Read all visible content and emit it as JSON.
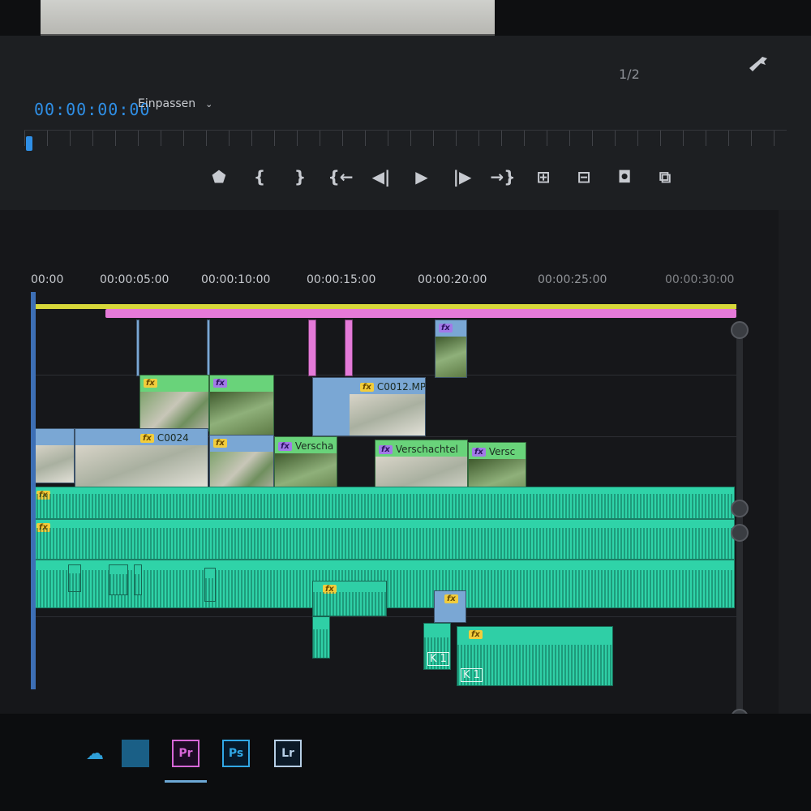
{
  "monitor": {
    "timecode": "00:00:00:00",
    "fit_label": "Einpassen",
    "resolution": "1/2"
  },
  "transport": [
    {
      "name": "add-marker-button",
      "icon": "marker-icon",
      "glyph": "⬟"
    },
    {
      "name": "mark-in-button",
      "icon": "mark-in-icon",
      "glyph": "{"
    },
    {
      "name": "mark-out-button",
      "icon": "mark-out-icon",
      "glyph": "}"
    },
    {
      "name": "go-to-in-button",
      "icon": "go-to-in-icon",
      "glyph": "{←"
    },
    {
      "name": "step-back-button",
      "icon": "step-back-icon",
      "glyph": "◀|"
    },
    {
      "name": "play-button",
      "icon": "play-icon",
      "glyph": "▶"
    },
    {
      "name": "step-forward-button",
      "icon": "step-forward-icon",
      "glyph": "|▶"
    },
    {
      "name": "go-to-out-button",
      "icon": "go-to-out-icon",
      "glyph": "→}"
    },
    {
      "name": "lift-button",
      "icon": "lift-icon",
      "glyph": "⊞"
    },
    {
      "name": "extract-button",
      "icon": "extract-icon",
      "glyph": "⊟"
    },
    {
      "name": "export-frame-button",
      "icon": "camera-icon",
      "glyph": "◘"
    },
    {
      "name": "compare-view-button",
      "icon": "compare-icon",
      "glyph": "⧉"
    }
  ],
  "timeline": {
    "ruler": [
      "00:00",
      "00:00:05:00",
      "00:00:10:00",
      "00:00:15:00",
      "00:00:20:00",
      "00:00:25:00",
      "00:00:30:00"
    ],
    "clips": {
      "clip_c0024": "C0024",
      "clip_c0012": "C0012.MP",
      "clip_nested_1": "Verscha",
      "clip_nested_2": "Verschachtel",
      "clip_nested_3": "Versc",
      "fx": "fx",
      "k1_a": "K 1",
      "k1_b": "K 1"
    },
    "label_track_audio": "fx"
  },
  "taskbar": {
    "pr": "Pr",
    "ps": "Ps",
    "lr": "Lr"
  },
  "colors": {
    "accent_blue": "#2f8fe6",
    "work_area": "#d7d73a",
    "in_out": "#e57ad8",
    "audio_clip": "#2fd3a8",
    "video_clip": "#7aa7d4",
    "nested_clip": "#69d37a"
  }
}
